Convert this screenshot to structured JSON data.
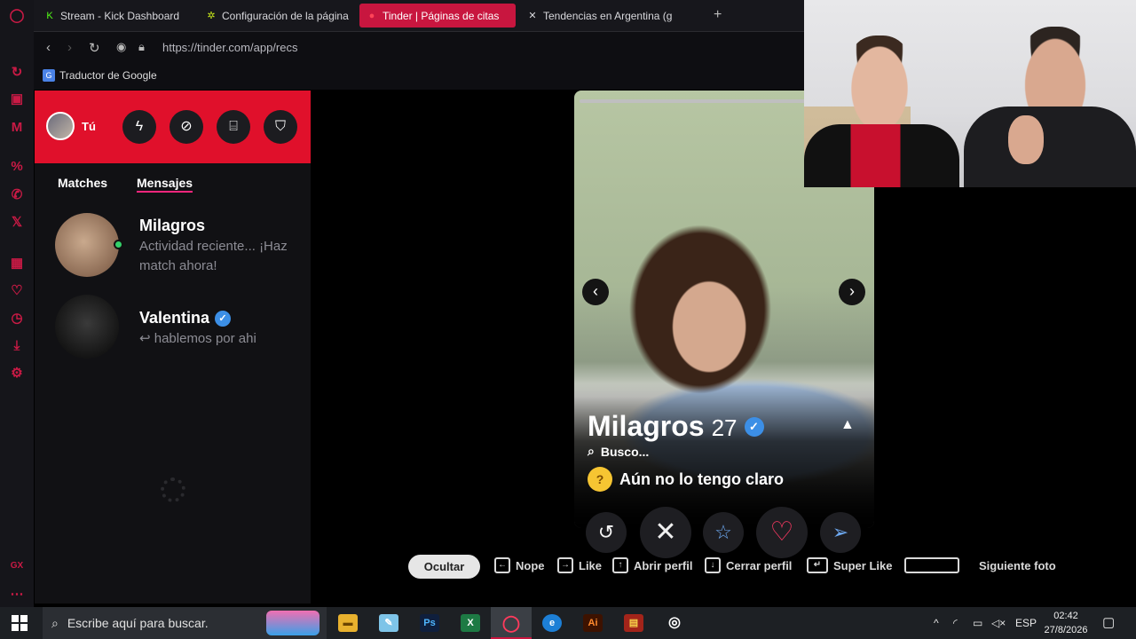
{
  "browser": {
    "tabs": [
      {
        "label": "Stream - Kick Dashboard",
        "icon": "kick-icon",
        "color": "#53fc18"
      },
      {
        "label": "Configuración de la página",
        "icon": "gear-icon",
        "color": "#c4e41a"
      },
      {
        "label": "Tinder | Páginas de citas",
        "icon": "tinder-icon",
        "color": "#ff4458",
        "active": true
      },
      {
        "label": "Tendencias en Argentina (g",
        "icon": "x-icon",
        "color": "#ffffff"
      }
    ],
    "url": "https://tinder.com/app/recs",
    "bookmark": "Traductor de Google"
  },
  "tinder": {
    "me_label": "Tú",
    "tabs": {
      "matches": "Matches",
      "messages": "Mensajes"
    },
    "conversations": [
      {
        "name": "Milagros",
        "message": "Actividad reciente... ¡Haz match ahora!",
        "online": true,
        "verified": false
      },
      {
        "name": "Valentina",
        "message": "↩ hablemos por ahi",
        "online": false,
        "verified": true
      }
    ],
    "profile": {
      "name": "Milagros",
      "age": "27",
      "looking_for_label": "Busco...",
      "looking_for": "Aún no lo tengo claro",
      "photo_count": 1
    },
    "shortcuts": {
      "hide": "Ocultar",
      "nope": "Nope",
      "like": "Like",
      "open_profile": "Abrir perfil",
      "close_profile": "Cerrar perfil",
      "super_like": "Super Like",
      "next_photo": "Siguiente foto"
    },
    "accent": "#fd267d",
    "header_color": "#e0102b"
  },
  "taskbar": {
    "search_placeholder": "Escribe aquí para buscar.",
    "language": "ESP",
    "time": "02:42",
    "date": "27/8/2026"
  }
}
